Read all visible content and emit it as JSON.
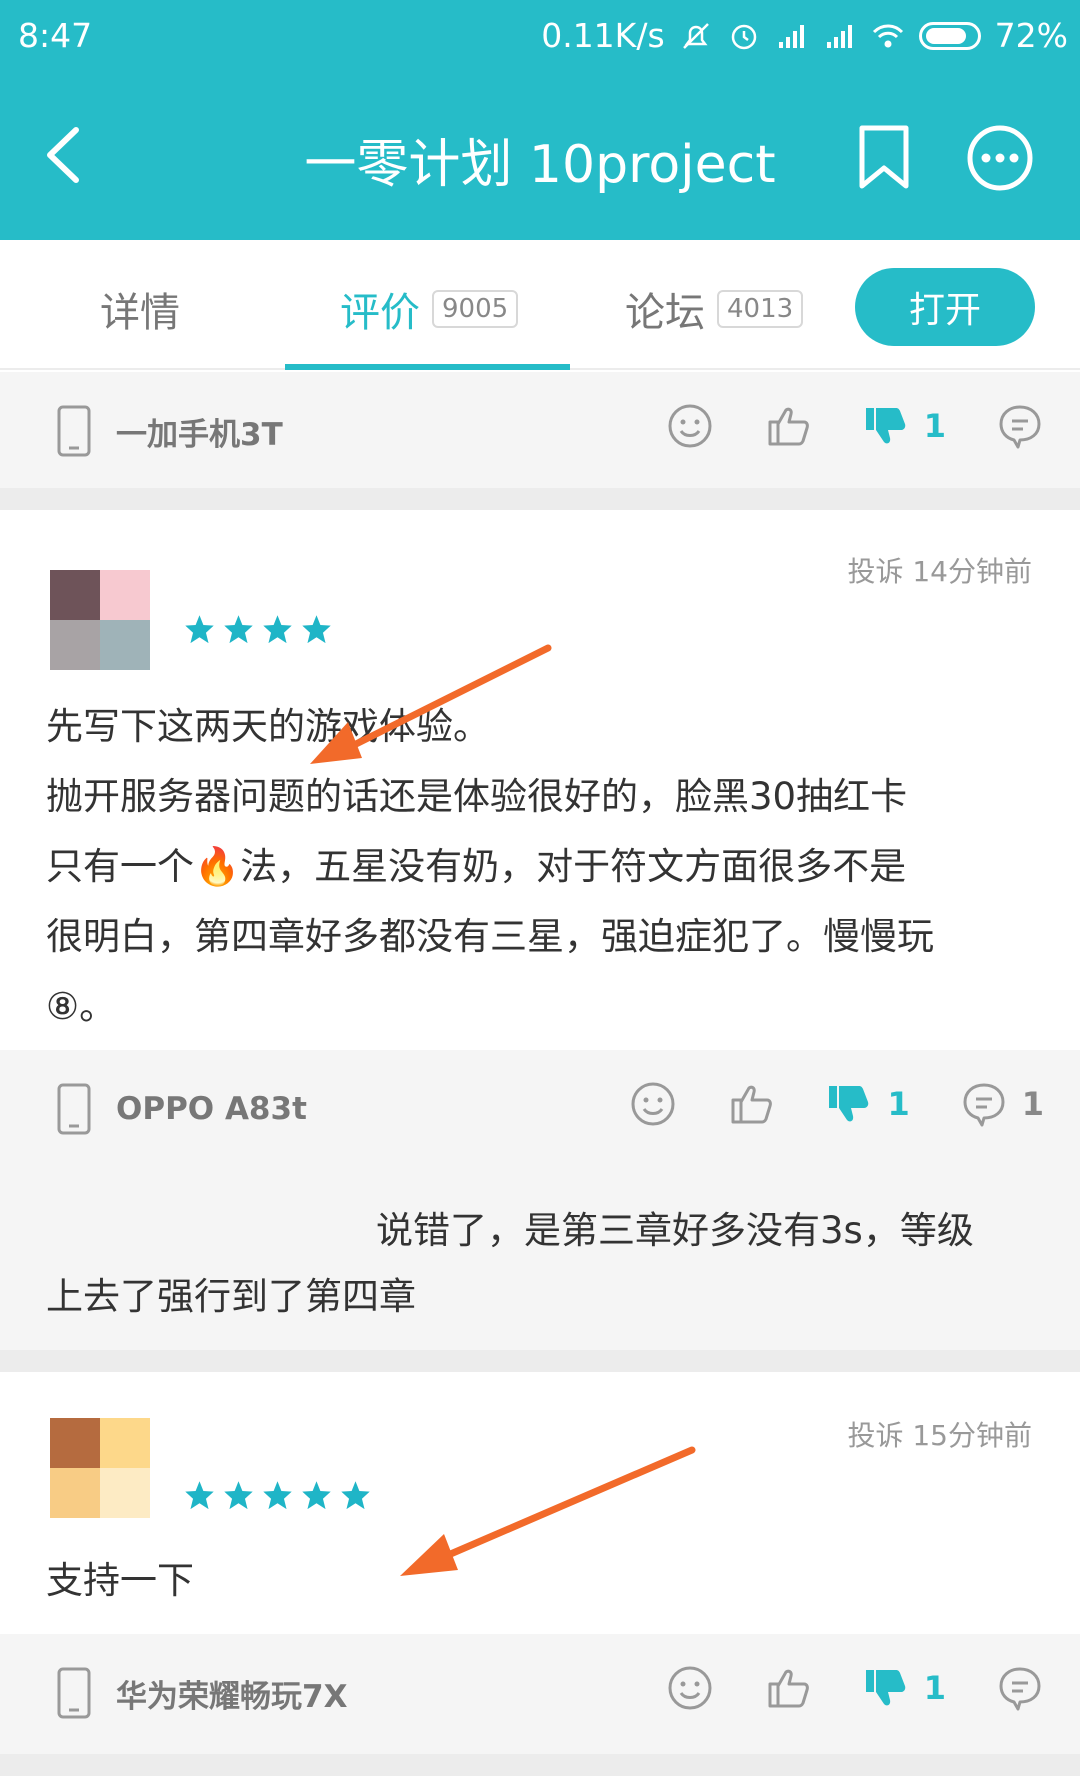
{
  "status_bar": {
    "time": "8:47",
    "speed": "0.11K/s",
    "battery": "72%"
  },
  "header": {
    "title": "一零计划 10project"
  },
  "tabs": [
    {
      "label": "详情",
      "count": ""
    },
    {
      "label": "评价",
      "count": "9005"
    },
    {
      "label": "论坛",
      "count": "4013"
    }
  ],
  "open_button": "打开",
  "colors": {
    "accent": "#26bcc8",
    "star": "#1fb5c7",
    "arrow": "#f26a2a"
  },
  "top_footer": {
    "device": "一加手机3T",
    "dislike_count": "1"
  },
  "reviews": [
    {
      "meta": "投诉 14分钟前",
      "stars": 4,
      "lines": [
        "先写下这两天的游戏体验。",
        "抛开服务器问题的话还是体验很好的，脸黑30抽红卡",
        "只有一个🔥法，五星没有奶，对于符文方面很多不是",
        "很明白，第四章好多都没有三星，强迫症犯了。慢慢玩",
        "⑧。"
      ],
      "device": "OPPO A83t",
      "dislike_count": "1",
      "reply_count": "1",
      "reply_lines": [
        "说错了，是第三章好多没有3s，等级",
        "上去了强行到了第四章"
      ]
    },
    {
      "meta": "投诉 15分钟前",
      "stars": 5,
      "lines": [
        "支持一下"
      ],
      "device": "华为荣耀畅玩7X",
      "dislike_count": "1"
    }
  ]
}
